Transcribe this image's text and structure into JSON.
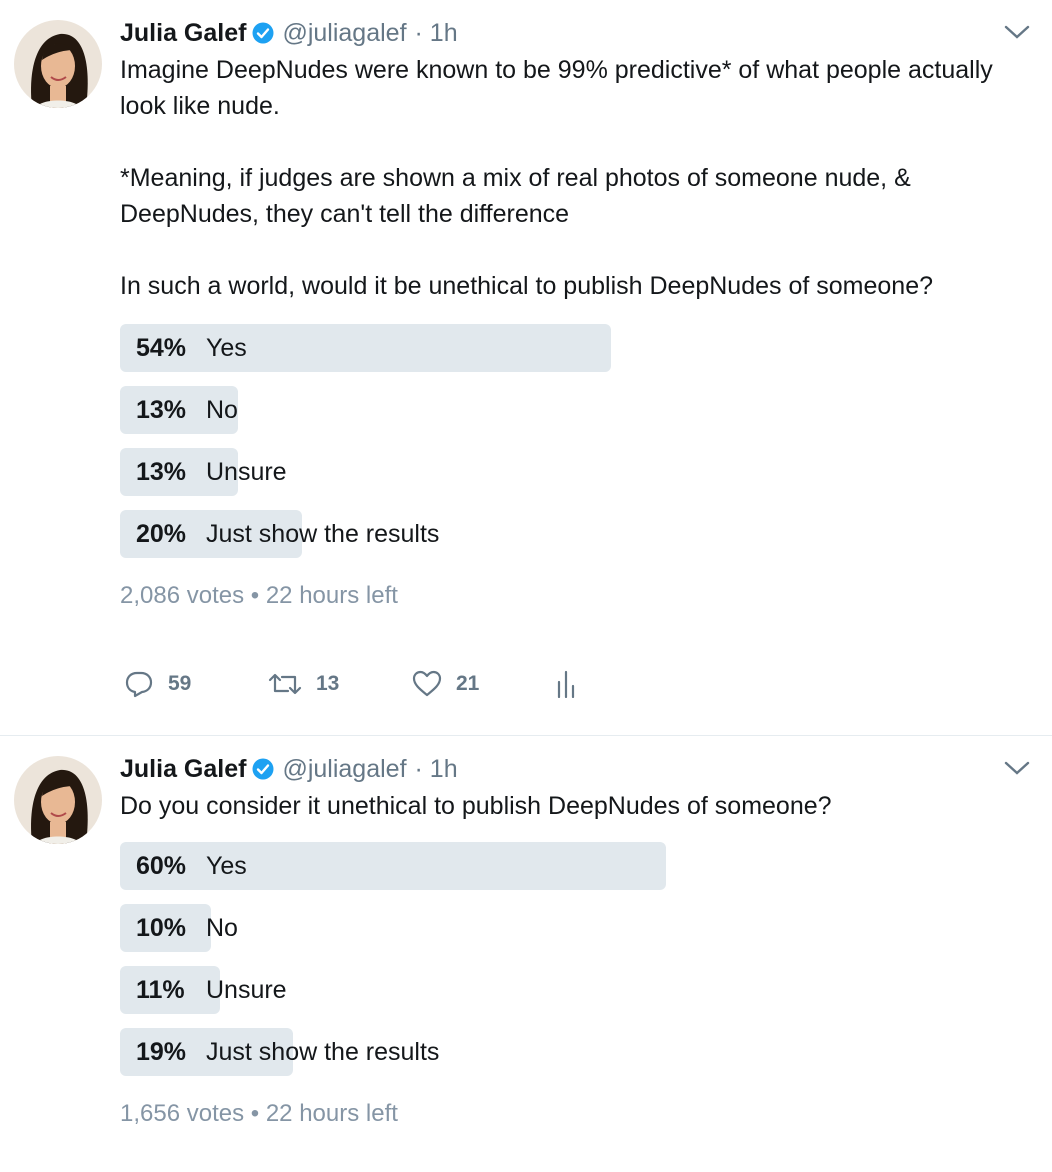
{
  "tweets": [
    {
      "name": "Julia Galef",
      "handle": "@juliagalef",
      "time": "· 1h",
      "paragraphs": [
        "Imagine DeepNudes were known to be 99% predictive* of what people actually look like nude.",
        "*Meaning, if judges are shown a mix of real photos of someone nude, & DeepNudes, they can't tell the difference",
        "In such a world, would it be unethical to publish DeepNudes of someone?"
      ],
      "poll": [
        {
          "percent": "54%",
          "label": "Yes",
          "share": 0.54
        },
        {
          "percent": "13%",
          "label": "No",
          "share": 0.13
        },
        {
          "percent": "13%",
          "label": "Unsure",
          "share": 0.13
        },
        {
          "percent": "20%",
          "label": "Just show the results",
          "share": 0.2
        }
      ],
      "meta": "2,086 votes • 22 hours left",
      "actions": {
        "replies": "59",
        "retweets": "13",
        "likes": "21"
      }
    },
    {
      "name": "Julia Galef",
      "handle": "@juliagalef",
      "time": "· 1h",
      "paragraphs": [
        "Do you consider it unethical to publish DeepNudes of someone?"
      ],
      "poll": [
        {
          "percent": "60%",
          "label": "Yes",
          "share": 0.6
        },
        {
          "percent": "10%",
          "label": "No",
          "share": 0.1
        },
        {
          "percent": "11%",
          "label": "Unsure",
          "share": 0.11
        },
        {
          "percent": "19%",
          "label": "Just show the results",
          "share": 0.19
        }
      ],
      "meta": "1,656 votes • 22 hours left"
    }
  ],
  "icons": {
    "verified": "verified-badge-icon",
    "chevron": "chevron-down-icon",
    "reply": "reply-icon",
    "retweet": "retweet-icon",
    "like": "heart-icon",
    "analytics": "analytics-icon"
  },
  "colors": {
    "bar": "#e1e8ed",
    "secondary_text": "#657786",
    "verified": "#1da1f2"
  }
}
